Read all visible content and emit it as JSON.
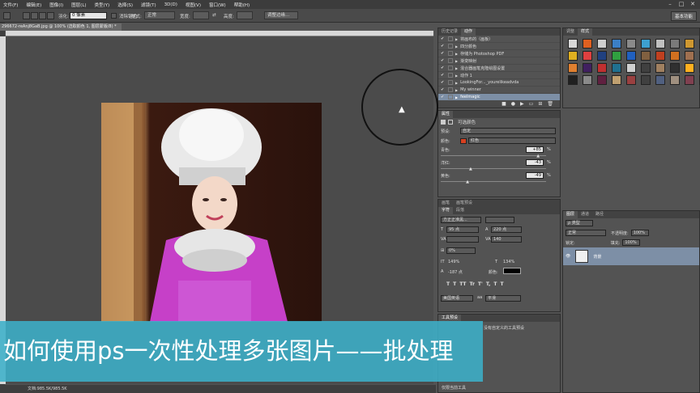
{
  "menubar": {
    "items": [
      "文件(F)",
      "编辑(E)",
      "图像(I)",
      "图层(L)",
      "类型(Y)",
      "选择(S)",
      "滤镜(T)",
      "3D(D)",
      "视图(V)",
      "窗口(W)",
      "帮助(H)"
    ]
  },
  "window_controls": [
    "–",
    "□",
    "✕"
  ],
  "options_bar": {
    "feather_label": "羽化:",
    "feather_value": "0 像素",
    "antialias_label": "消除锯齿",
    "style_label": "样式:",
    "style_value": "正常",
    "width_label": "宽度:",
    "height_label": "高度:",
    "refine_button": "调整边缘..."
  },
  "workspace_button": "基本功能",
  "document": {
    "tab_title": "296672-reAnj8GaB.jpg @ 100% (选取颜色 1, 图层蒙版/8) *",
    "status_text": "文档:985.5K/985.5K"
  },
  "history_panel": {
    "tabs": [
      "历史记录",
      "动作"
    ],
    "rows": [
      {
        "label": "将画布的（画板）",
        "checked": true
      },
      {
        "label": "四分颜色",
        "checked": true
      },
      {
        "label": "存储为 Photoshop PDF",
        "checked": true
      },
      {
        "label": "渐变映射",
        "checked": true
      },
      {
        "label": "混合器画笔克隆绘图设置",
        "checked": true
      },
      {
        "label": "动作 1",
        "checked": true
      },
      {
        "label": "LookingFor..._yourelikeadvda",
        "checked": true
      },
      {
        "label": "My winner",
        "checked": true
      },
      {
        "label": "feelmagic",
        "checked": true,
        "selected": true
      }
    ]
  },
  "styles_panel": {
    "tabs": [
      "调整",
      "样式"
    ],
    "swatches": [
      "#d8d8d8",
      "#e06020",
      "#cfcfcf",
      "#3b7fc6",
      "#8a8a8a",
      "#3da0d0",
      "#c0c0c0",
      "#7a7a7a",
      "#cf9830",
      "#b08040",
      "#e0b020",
      "#e04040",
      "#204080",
      "#30a040",
      "#2060c0",
      "#806040",
      "#c04020",
      "#d07020",
      "#a07050",
      "#505050",
      "#e08030",
      "#402060",
      "#c03030",
      "#207090",
      "#d0d0d0",
      "#404040",
      "#a08060",
      "#303030",
      "#ffb020",
      "#606060",
      "#202020",
      "#8a8a8a",
      "#602040",
      "#c0a070",
      "#9a4040",
      "#404040",
      "#506080",
      "#a09080",
      "#804050",
      "#703030"
    ]
  },
  "properties_panel": {
    "tabs": [
      "属性"
    ],
    "title": "可选颜色",
    "preset_label": "预设:",
    "preset_value": "自定",
    "color_label": "颜色:",
    "color_value": "红色",
    "color_swatch": "#d84020",
    "sliders": [
      {
        "label": "青色:",
        "value": "+85",
        "unit": "%",
        "level": 0.925
      },
      {
        "label": "洋红:",
        "value": "-43",
        "unit": "%",
        "level": 0.285
      },
      {
        "label": "黄色:",
        "value": "-49",
        "unit": "%",
        "level": 0.255
      }
    ]
  },
  "character_panel": {
    "tabs": [
      "字符",
      "段落"
    ],
    "mini_tabs": [
      "画笔",
      "画笔预设"
    ],
    "font_family": "方正正准黑...",
    "font_size": "95 点",
    "leading": "220 点",
    "kerning": "",
    "tracking": "140",
    "baseline_shift": "0%",
    "vertical_scale": "149%",
    "horizontal_scale": "134%",
    "baseline_value": "-187 点",
    "color_label": "颜色:",
    "language": "美国英语",
    "antialias": "平滑",
    "style_buttons": [
      "T",
      "T",
      "TT",
      "Tr",
      "T'",
      "T,",
      "T",
      "T"
    ],
    "tool_preset_tab": "工具预设",
    "tool_preset_note": "没有自定义的工具预设",
    "current_tool_label": "仅限当前工具"
  },
  "layers_panel": {
    "tabs": [
      "图层",
      "通道",
      "路径"
    ],
    "kind_label": "ρ 类型",
    "blend_value": "正常",
    "opacity_label": "不透明度:",
    "opacity_value": "100%",
    "lock_label": "锁定:",
    "fill_label": "填充:",
    "fill_value": "100%",
    "layers": [
      {
        "name": "背景",
        "visible": true
      }
    ]
  },
  "overlay": {
    "caption": "如何使用ps一次性处理多张图片——批处理"
  }
}
